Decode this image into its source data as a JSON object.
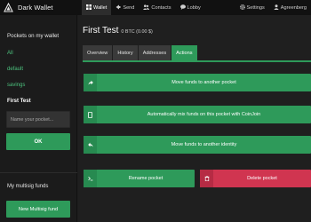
{
  "app": {
    "name": "Dark Wallet"
  },
  "nav": {
    "items": [
      {
        "label": "Wallet",
        "icon": "grid-icon",
        "active": true
      },
      {
        "label": "Send",
        "icon": "send-icon"
      },
      {
        "label": "Contacts",
        "icon": "contacts-icon"
      },
      {
        "label": "Lobby",
        "icon": "lobby-icon"
      }
    ],
    "right": [
      {
        "label": "Settings",
        "icon": "gear-icon"
      },
      {
        "label": "Agreenberg",
        "icon": "user-icon"
      }
    ]
  },
  "sidebar": {
    "title": "Pockets on my wallet",
    "pockets": [
      {
        "label": "All"
      },
      {
        "label": "default"
      },
      {
        "label": "savings"
      },
      {
        "label": "First Test",
        "current": true
      }
    ],
    "input_placeholder": "Name your pocket...",
    "ok_label": "OK",
    "multisig_title": "My multisig funds",
    "multisig_button": "New Multisig fund"
  },
  "main": {
    "title": "First Test",
    "balance": "0 BTC (0.00 $)",
    "tabs": [
      "Overview",
      "History",
      "Addresses",
      "Actions"
    ],
    "active_tab": "Actions",
    "actions": {
      "move_funds": "Move funds to another pocket",
      "mix_funds": "Automatically mix funds on this pocket with CoinJoin",
      "move_identity": "Move funds to another identity",
      "rename": "Rename pocket",
      "delete": "Delete pocket"
    }
  },
  "colors": {
    "accent": "#2e9a5a",
    "danger": "#d03550",
    "background": "#1d1d1d"
  }
}
